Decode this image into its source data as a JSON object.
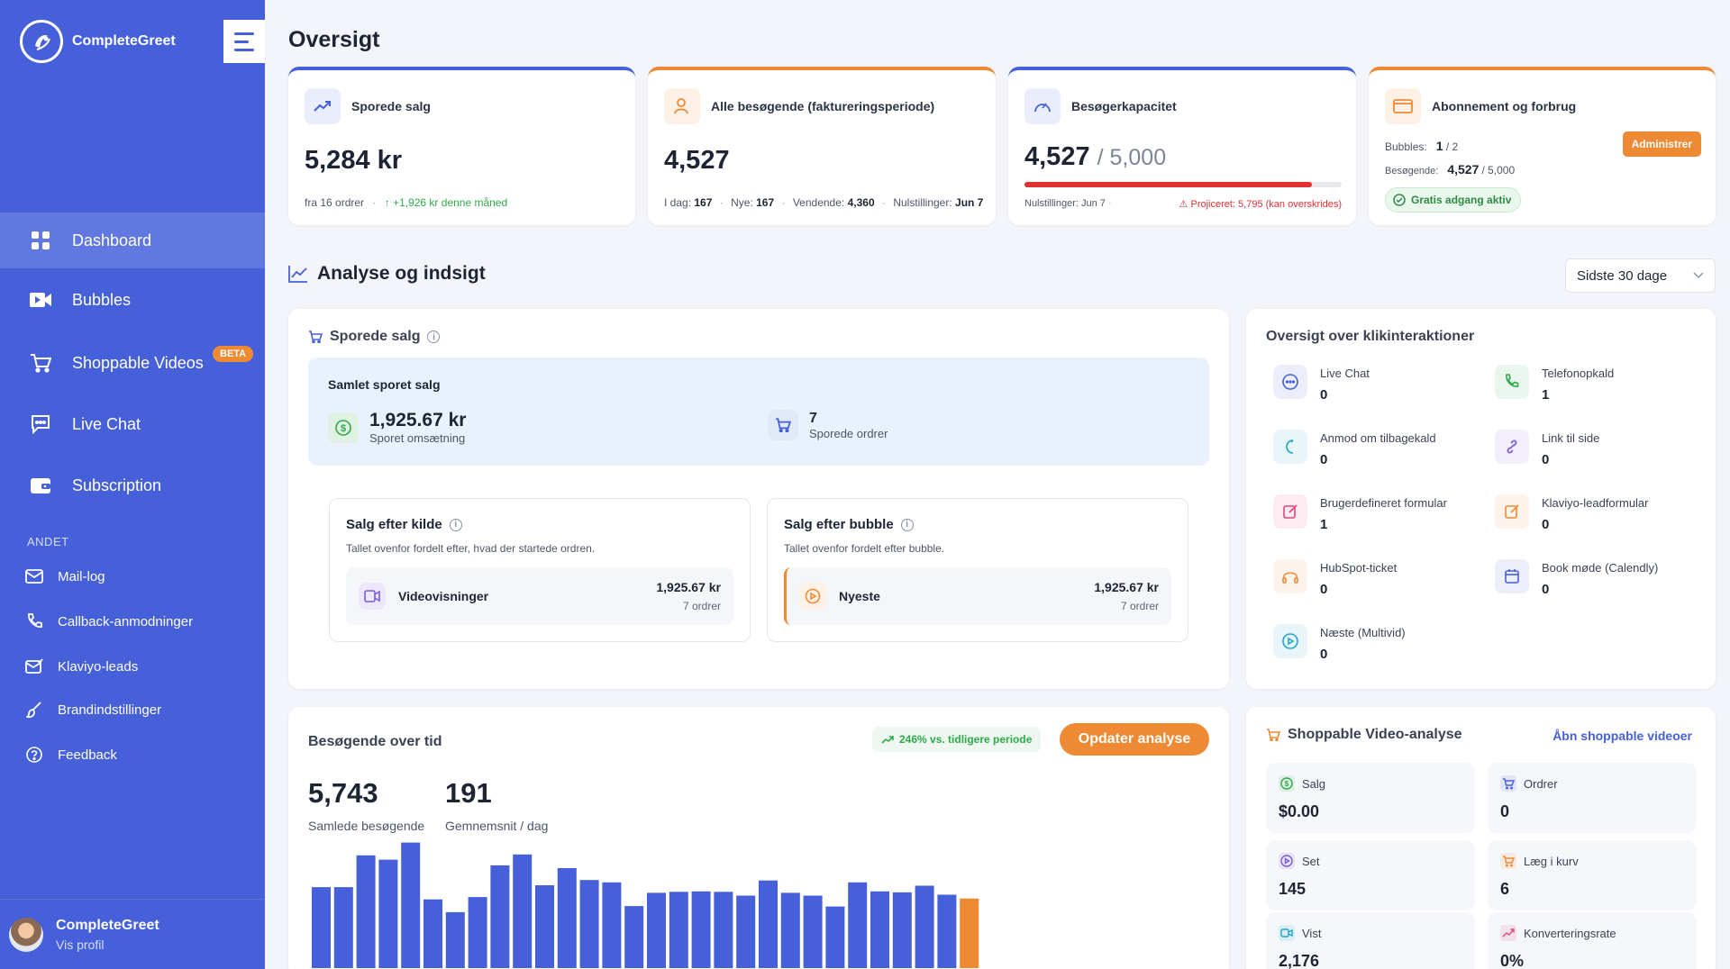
{
  "sidebar": {
    "brand_name": "CompleteGreet",
    "nav": [
      {
        "label": "Dashboard",
        "icon": "dashboard-icon"
      },
      {
        "label": "Bubbles",
        "icon": "video-camera-icon"
      },
      {
        "label": "Shoppable Videos",
        "icon": "cart-icon",
        "badge": "BETA"
      },
      {
        "label": "Live Chat",
        "icon": "chat-icon"
      },
      {
        "label": "Subscription",
        "icon": "wallet-icon"
      }
    ],
    "section_label": "ANDET",
    "other": [
      {
        "label": "Mail-log",
        "icon": "mail-icon"
      },
      {
        "label": "Callback-anmodninger",
        "icon": "phone-icon"
      },
      {
        "label": "Klaviyo-leads",
        "icon": "mail-check-icon"
      },
      {
        "label": "Brandindstillinger",
        "icon": "brush-icon"
      },
      {
        "label": "Feedback",
        "icon": "help-circle-icon"
      }
    ],
    "profile": {
      "name": "CompleteGreet",
      "link": "Vis profil"
    }
  },
  "page_title": "Oversigt",
  "stats": {
    "sales": {
      "title": "Sporede salg",
      "value": "5,284 kr",
      "foot_left": "fra 16 ordrer",
      "foot_trend": "+1,926 kr denne måned"
    },
    "visitors": {
      "title": "Alle besøgende (faktureringsperiode)",
      "value": "4,527",
      "foot": [
        {
          "label": "I dag:",
          "value": "167"
        },
        {
          "label": "Nye:",
          "value": "167"
        },
        {
          "label": "Vendende:",
          "value": "4,360"
        },
        {
          "label": "Nulstillinger:",
          "value": "Jun 7"
        }
      ]
    },
    "capacity": {
      "title": "Besøgerkapacitet",
      "value": "4,527",
      "limit": "/ 5,000",
      "usage_fraction": 0.905,
      "reset": "Nulstillinger: Jun 7",
      "warning": "Projiceret: 5,795 (kan overskrides)"
    },
    "subscription": {
      "title": "Abonnement og forbrug",
      "bubbles_label": "Bubbles:",
      "bubbles_value": "1",
      "bubbles_limit": "/ 2",
      "visitors_label": "Besøgende:",
      "visitors_value": "4,527",
      "visitors_limit": "/ 5,000",
      "manage_button": "Administrer",
      "free_badge": "Gratis adgang aktiv"
    }
  },
  "analysis": {
    "title": "Analyse og indsigt",
    "range": "Sidste 30 dage",
    "tracked_sales": {
      "title": "Sporede salg",
      "summary_title": "Samlet sporet salg",
      "revenue_value": "1,925.67 kr",
      "revenue_label": "Sporet omsætning",
      "orders_value": "7",
      "orders_label": "Sporede ordrer",
      "by_source": {
        "title": "Salg efter kilde",
        "desc": "Tallet ovenfor fordelt efter, hvad der startede ordren.",
        "row_name": "Videovisninger",
        "row_amount": "1,925.67 kr",
        "row_count": "7 ordrer"
      },
      "by_bubble": {
        "title": "Salg efter bubble",
        "desc": "Tallet ovenfor fordelt efter bubble.",
        "row_name": "Nyeste",
        "row_amount": "1,925.67 kr",
        "row_count": "7 ordrer"
      }
    },
    "interactions": {
      "title": "Oversigt over klikinteraktioner",
      "items": [
        {
          "label": "Live Chat",
          "value": "0",
          "icon": "chat-bubble-icon",
          "color": "#4660d9"
        },
        {
          "label": "Telefonopkald",
          "value": "1",
          "icon": "phone-icon",
          "color": "#2eaa4a"
        },
        {
          "label": "Anmod om tilbagekald",
          "value": "0",
          "icon": "callback-icon",
          "color": "#1fa6c9"
        },
        {
          "label": "Link til side",
          "value": "0",
          "icon": "link-icon",
          "color": "#7d5bd6"
        },
        {
          "label": "Brugerdefineret formular",
          "value": "1",
          "icon": "edit-form-icon",
          "color": "#e0457b"
        },
        {
          "label": "Klaviyo-leadformular",
          "value": "0",
          "icon": "edit-form-icon",
          "color": "#ee8a33"
        },
        {
          "label": "HubSpot-ticket",
          "value": "0",
          "icon": "headset-icon",
          "color": "#ee8a33"
        },
        {
          "label": "Book møde (Calendly)",
          "value": "0",
          "icon": "calendar-icon",
          "color": "#4660d9"
        },
        {
          "label": "Næste (Multivid)",
          "value": "0",
          "icon": "play-circle-icon",
          "color": "#1fa6c9"
        }
      ]
    },
    "visitors_over_time": {
      "title": "Besøgende over tid",
      "trend": "246% vs. tidligere periode",
      "update_button": "Opdater analyse",
      "total_value": "5,743",
      "total_label": "Samlede besøgende",
      "avg_value": "191",
      "avg_label": "Gemnemsnit / dag"
    },
    "shoppable": {
      "title": "Shoppable Video-analyse",
      "link": "Åbn shoppable videoer",
      "metrics": [
        {
          "label": "Salg",
          "value": "$0.00",
          "icon": "dollar-icon",
          "color": "#2eaa4a"
        },
        {
          "label": "Ordrer",
          "value": "0",
          "icon": "cart-icon",
          "color": "#4660d9"
        },
        {
          "label": "Set",
          "value": "145",
          "icon": "play-icon",
          "color": "#7d5bd6"
        },
        {
          "label": "Læg i kurv",
          "value": "6",
          "icon": "cart-icon",
          "color": "#ee8a33"
        },
        {
          "label": "Vist",
          "value": "2,176",
          "icon": "video-icon",
          "color": "#1fa6c9"
        },
        {
          "label": "Konverteringsrate",
          "value": "0%",
          "icon": "trend-icon",
          "color": "#e0457b"
        }
      ]
    }
  },
  "chart_data": {
    "type": "bar",
    "title": "Besøgende over tid",
    "values": [
      171,
      171,
      238,
      229,
      265,
      145,
      118,
      150,
      217,
      240,
      175,
      211,
      186,
      181,
      131,
      159,
      161,
      162,
      161,
      153,
      185,
      159,
      153,
      130,
      181,
      162,
      160,
      174,
      155,
      147
    ],
    "highlight_last": true,
    "colors": {
      "bar": "#4660d9",
      "current": "#ee8a33"
    }
  }
}
